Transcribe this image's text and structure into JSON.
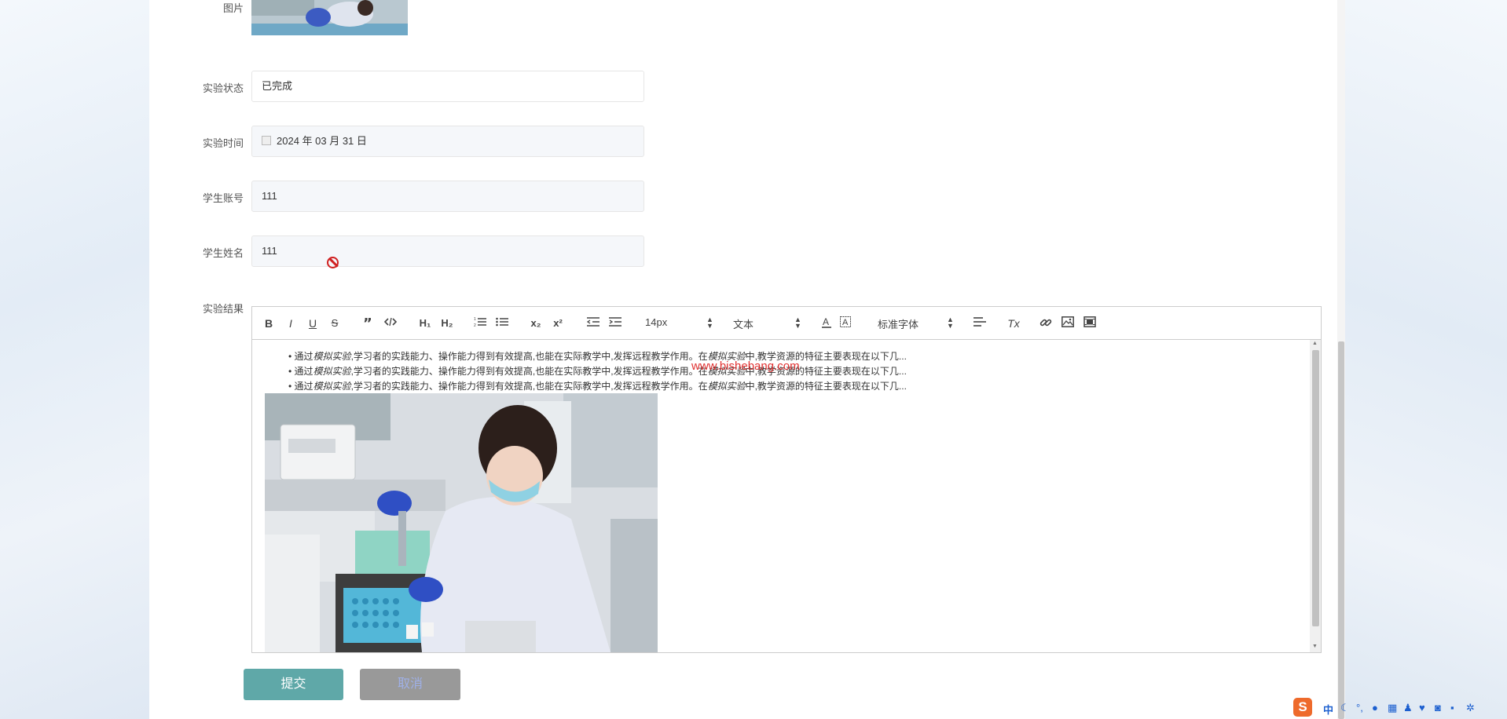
{
  "form": {
    "image_label": "图片",
    "status": {
      "label": "实验状态",
      "value": "已完成"
    },
    "time": {
      "label": "实验时间",
      "value": "2024 年 03 月 31 日"
    },
    "student_account": {
      "label": "学生账号",
      "value": "111"
    },
    "student_name": {
      "label": "学生姓名",
      "value": "111"
    },
    "result": {
      "label": "实验结果"
    }
  },
  "toolbar": {
    "bold": "B",
    "italic": "I",
    "underline": "U",
    "strike": "S",
    "h1": "H₁",
    "h2": "H₂",
    "subscript": "x₂",
    "superscript": "x²",
    "size": "14px",
    "header_type": "文本",
    "font": "标准字体",
    "clean": "Tx"
  },
  "content": {
    "bullets": [
      {
        "a": "• 通过",
        "em": "模拟实验",
        "b": ",学习者的实践能力、操作能力得到有效提高,也能在实际教学中,发挥远程教学作用。在",
        "em2": "模拟实验",
        "c": "中,教学资源的特征主要表现在以下几..."
      },
      {
        "a": "• 通过",
        "em": "模拟实验",
        "b": ",学习者的实践能力、操作能力得到有效提高,也能在实际教学中,发挥远程教学作用。在",
        "em2": "模拟实验",
        "c": "中,教学资源的特征主要表现在以下几..."
      },
      {
        "a": "• 通过",
        "em": "模拟实验",
        "b": ",学习者的实践能力、操作能力得到有效提高,也能在实际教学中,发挥远程教学作用。在",
        "em2": "模拟实验",
        "c": "中,教学资源的特征主要表现在以下几..."
      }
    ],
    "watermark": "www.bishebang.com"
  },
  "buttons": {
    "submit": "提交",
    "cancel": "取消"
  },
  "tray": {
    "logo": "S",
    "lang": "中"
  },
  "colors": {
    "submit": "#5fa8a8",
    "cancel": "#999999",
    "watermark": "#e03030"
  }
}
